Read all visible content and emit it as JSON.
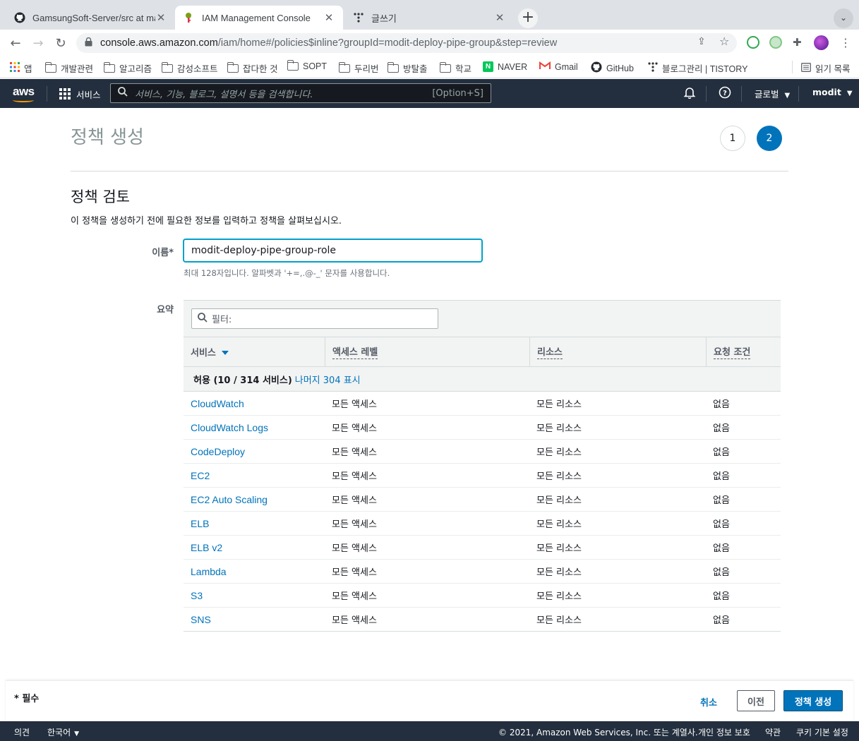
{
  "browser": {
    "tabs": [
      {
        "title": "GamsungSoft-Server/src at ma",
        "icon": "github-icon"
      },
      {
        "title": "IAM Management Console",
        "icon": "aws-iam-icon"
      },
      {
        "title": "글쓰기",
        "icon": "tistory-icon"
      }
    ],
    "url_host": "console.aws.amazon.com",
    "url_path": "/iam/home#/policies$inline?groupId=modit-deploy-pipe-group&step=review",
    "bookmarks": [
      "앱",
      "개발관련",
      "알고리즘",
      "감성소프트",
      "잡다한 것",
      "SOPT",
      "두리번",
      "방탈출",
      "학교",
      "NAVER",
      "Gmail",
      "GitHub",
      "블로그관리 | TISTORY"
    ],
    "reading_list": "읽기 목록"
  },
  "aws_header": {
    "logo": "aws",
    "services": "서비스",
    "search_placeholder": "서비스, 기능, 블로그, 설명서 등을 검색합니다.",
    "search_shortcut": "[Option+S]",
    "region": "글로벌",
    "user": "modit"
  },
  "page": {
    "title": "정책 생성",
    "steps": [
      "1",
      "2"
    ],
    "section_title": "정책 검토",
    "section_desc": "이 정책을 생성하기 전에 필요한 정보를 입력하고 정책을 살펴보십시오.",
    "name_label": "이름*",
    "name_value": "modit-deploy-pipe-group-role",
    "name_hint": "최대 128자입니다. 알파벳과 '+=,.@-_' 문자를 사용합니다.",
    "summary_label": "요약",
    "filter_placeholder": "필터:"
  },
  "summary_table": {
    "columns": [
      "서비스",
      "액세스 레벨",
      "리소스",
      "요청 조건"
    ],
    "group_label": "허용 (10 / 314 서비스)",
    "group_link": "나머지 304 표시",
    "rows": [
      {
        "service": "CloudWatch",
        "access": "모든 액세스",
        "resource": "모든 리소스",
        "condition": "없음"
      },
      {
        "service": "CloudWatch Logs",
        "access": "모든 액세스",
        "resource": "모든 리소스",
        "condition": "없음"
      },
      {
        "service": "CodeDeploy",
        "access": "모든 액세스",
        "resource": "모든 리소스",
        "condition": "없음"
      },
      {
        "service": "EC2",
        "access": "모든 액세스",
        "resource": "모든 리소스",
        "condition": "없음"
      },
      {
        "service": "EC2 Auto Scaling",
        "access": "모든 액세스",
        "resource": "모든 리소스",
        "condition": "없음"
      },
      {
        "service": "ELB",
        "access": "모든 액세스",
        "resource": "모든 리소스",
        "condition": "없음"
      },
      {
        "service": "ELB v2",
        "access": "모든 액세스",
        "resource": "모든 리소스",
        "condition": "없음"
      },
      {
        "service": "Lambda",
        "access": "모든 액세스",
        "resource": "모든 리소스",
        "condition": "없음"
      },
      {
        "service": "S3",
        "access": "모든 액세스",
        "resource": "모든 리소스",
        "condition": "없음"
      },
      {
        "service": "SNS",
        "access": "모든 액세스",
        "resource": "모든 리소스",
        "condition": "없음"
      }
    ]
  },
  "actions": {
    "required_note": "* 필수",
    "cancel": "취소",
    "previous": "이전",
    "create": "정책 생성"
  },
  "footer": {
    "feedback": "의견",
    "language": "한국어",
    "copyright": "© 2021, Amazon Web Services, Inc. 또는 계열사.",
    "privacy": "개인 정보 보호",
    "terms": "약관",
    "cookies": "쿠키 기본 설정"
  },
  "colors": {
    "aws_nav": "#232f3e",
    "link": "#0073bb",
    "primary_button": "#0073bb"
  }
}
